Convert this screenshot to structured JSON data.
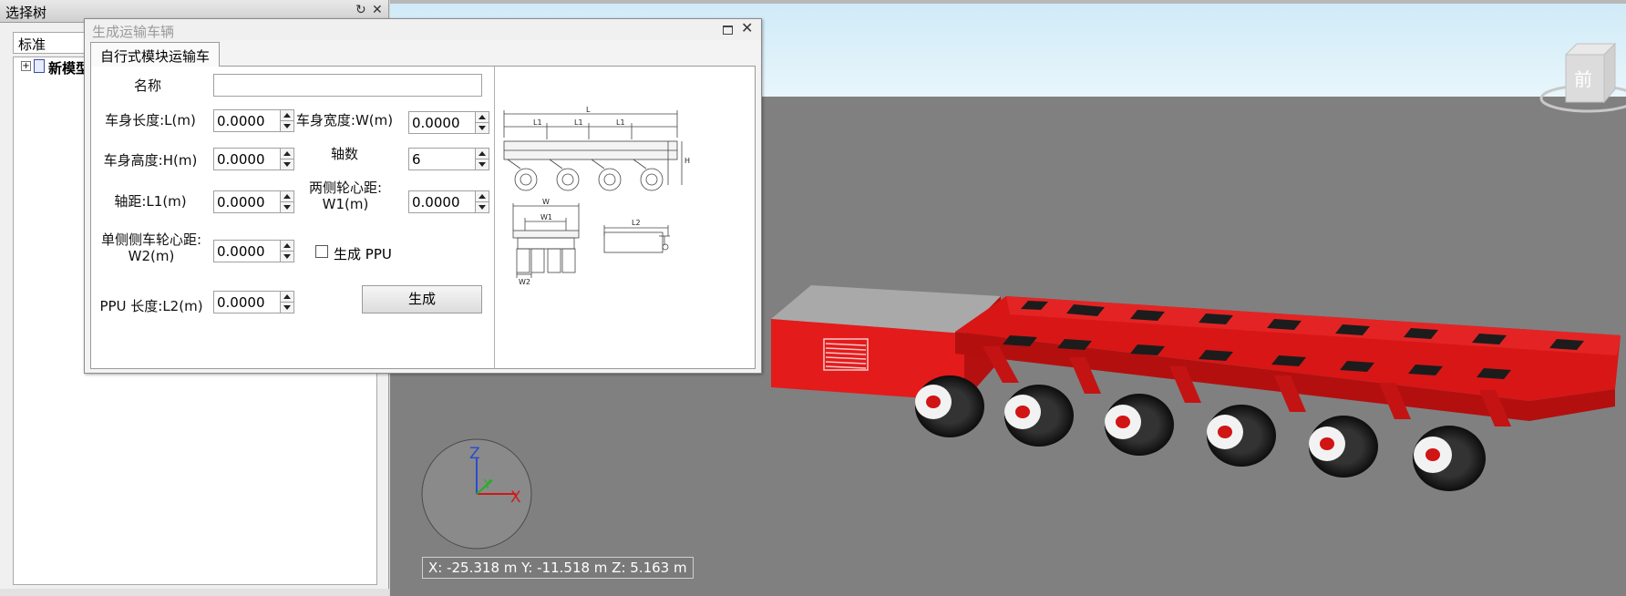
{
  "tree_panel": {
    "title": "选择树",
    "pin_icon": "↻",
    "close_icon": "✕",
    "filter_value": "标准",
    "node_label": "新模型",
    "expander": "+"
  },
  "dialog": {
    "title": "生成运输车辆",
    "close_icon": "✕",
    "tab_label": "自行式模块运输车",
    "name_label": "名称",
    "name_value": "",
    "fields": {
      "body_length": {
        "label": "车身长度:L(m)",
        "value": "0.0000"
      },
      "body_width": {
        "label": "车身宽度:W(m)",
        "value": "0.0000"
      },
      "body_height": {
        "label": "车身高度:H(m)",
        "value": "0.0000"
      },
      "axle_count": {
        "label": "轴数",
        "value": "6"
      },
      "axle_spacing": {
        "label": "轴距:L1(m)",
        "value": "0.0000"
      },
      "wheel_track_line1": "两侧轮心距:",
      "wheel_track_line2": "W1(m)",
      "wheel_track_value": "0.0000",
      "single_side_line1": "单侧侧车轮心距:",
      "single_side_line2": "W2(m)",
      "single_side_value": "0.0000",
      "ppu_length": {
        "label": "PPU 长度:L2(m)",
        "value": "0.0000"
      }
    },
    "ppu_checkbox_label": "生成 PPU",
    "ppu_checked": false,
    "generate_label": "生成",
    "diagram_labels": {
      "L": "L",
      "L1": "L1",
      "H": "H",
      "W": "W",
      "W1": "W1",
      "W2": "W2",
      "L2": "L2"
    }
  },
  "viewport": {
    "view_cube_label": "前",
    "axis_labels": {
      "x": "X",
      "y": "Y",
      "z": "Z"
    },
    "coordinates": "X: -25.318 m  Y: -11.518 m  Z: 5.163 m",
    "colors": {
      "sky": "#d9f0fa",
      "ground": "#808080",
      "vehicle_red": "#e11b1b",
      "tire": "#1a1a1a"
    }
  }
}
